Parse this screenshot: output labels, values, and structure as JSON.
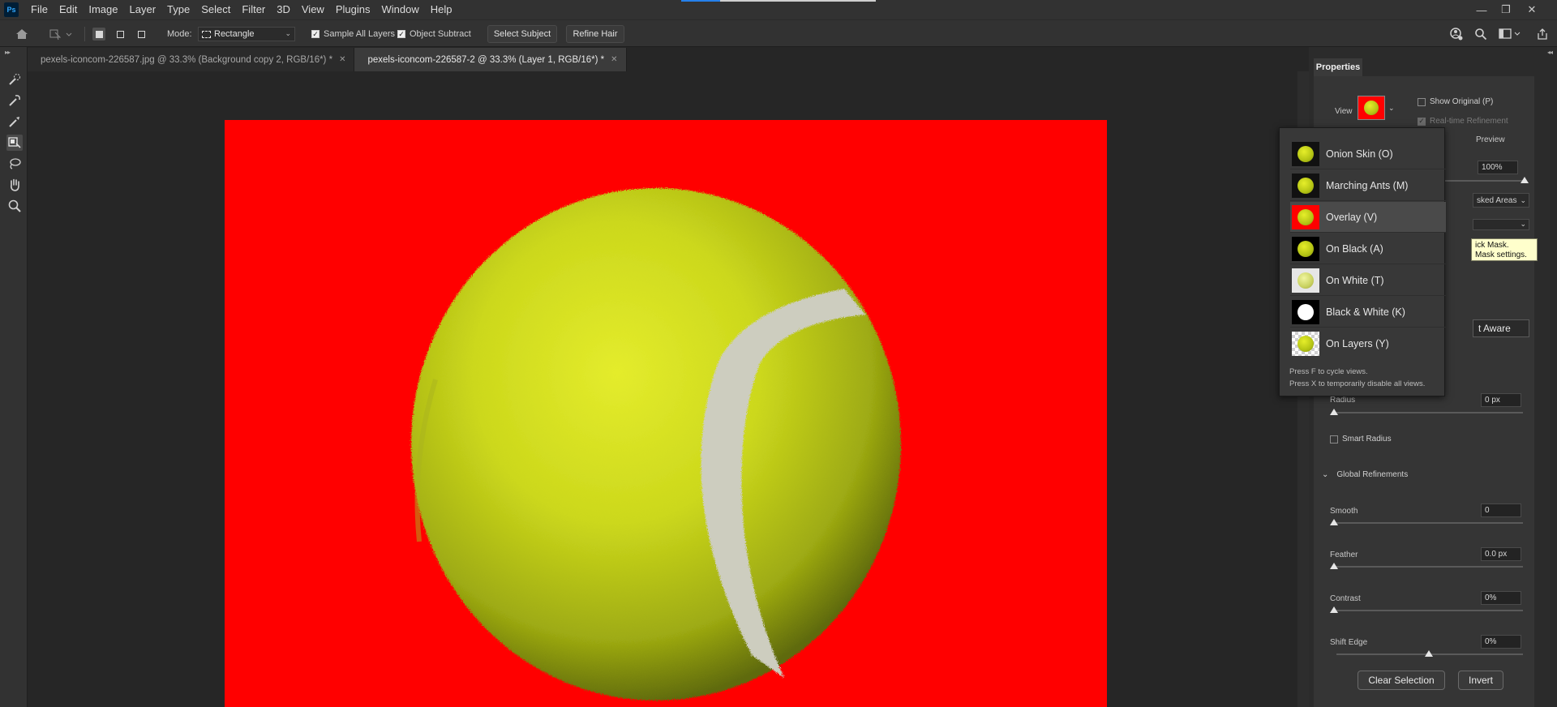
{
  "app": {
    "logo_text": "Ps"
  },
  "menu": [
    "File",
    "Edit",
    "Image",
    "Layer",
    "Type",
    "Select",
    "Filter",
    "3D",
    "View",
    "Plugins",
    "Window",
    "Help"
  ],
  "window_controls": {
    "minimize": "—",
    "restore": "❐",
    "close": "✕"
  },
  "options_bar": {
    "mode_label": "Mode:",
    "mode_value": "Rectangle",
    "sample_all_layers": {
      "label": "Sample All Layers",
      "checked": true
    },
    "object_subtract": {
      "label": "Object Subtract",
      "checked": true
    },
    "select_subject": "Select Subject",
    "refine_hair": "Refine Hair"
  },
  "tabs": [
    {
      "title": "pexels-iconcom-226587.jpg @ 33.3% (Background copy 2, RGB/16*) *",
      "active": false
    },
    {
      "title": "pexels-iconcom-226587-2 @ 33.3% (Layer 1, RGB/16*) *",
      "active": true
    }
  ],
  "tools": [
    "quick-selection-tool",
    "refine-edge-brush-tool",
    "brush-tool",
    "object-selection-tool",
    "lasso-tool",
    "hand-tool",
    "zoom-tool"
  ],
  "properties": {
    "tab": "Properties",
    "view_label": "View",
    "show_original": "Show Original (P)",
    "realtime_refinement": "Real-time Refinement",
    "preview_partial": "Preview",
    "opacity_value": "100%",
    "masked_areas_partial": "sked Areas",
    "object_aware_partial": "t Aware",
    "radius_label": "Radius",
    "radius_value": "0 px",
    "smart_radius": "Smart Radius",
    "global_refinements": "Global Refinements",
    "smooth_label": "Smooth",
    "smooth_value": "0",
    "feather_label": "Feather",
    "feather_value": "0.0 px",
    "contrast_label": "Contrast",
    "contrast_value": "0%",
    "shift_edge_label": "Shift Edge",
    "shift_edge_value": "0%",
    "clear_selection": "Clear Selection",
    "invert": "Invert"
  },
  "view_dropdown": {
    "options": [
      {
        "label": "Onion Skin (O)",
        "bg": "#111111",
        "selected": false
      },
      {
        "label": "Marching Ants (M)",
        "bg": "#111111",
        "selected": false
      },
      {
        "label": "Overlay (V)",
        "bg": "#ff0000",
        "selected": true
      },
      {
        "label": "On Black (A)",
        "bg": "#000000",
        "selected": false
      },
      {
        "label": "On White (T)",
        "bg": "#e6e6e6",
        "selected": false
      },
      {
        "label": "Black & White (K)",
        "bg": "#000000",
        "selected": false
      },
      {
        "label": "On Layers (Y)",
        "bg": "checker",
        "selected": false
      }
    ],
    "hint1": "Press F to cycle views.",
    "hint2": "Press X to temporarily disable all views."
  },
  "tooltip": {
    "line1": "ick Mask.",
    "line2": "Mask settings."
  },
  "colors": {
    "overlay_red": "#ff0000",
    "ball": "#c8d41a",
    "seam": "#cfcfc2",
    "ui_dark": "#262626"
  }
}
